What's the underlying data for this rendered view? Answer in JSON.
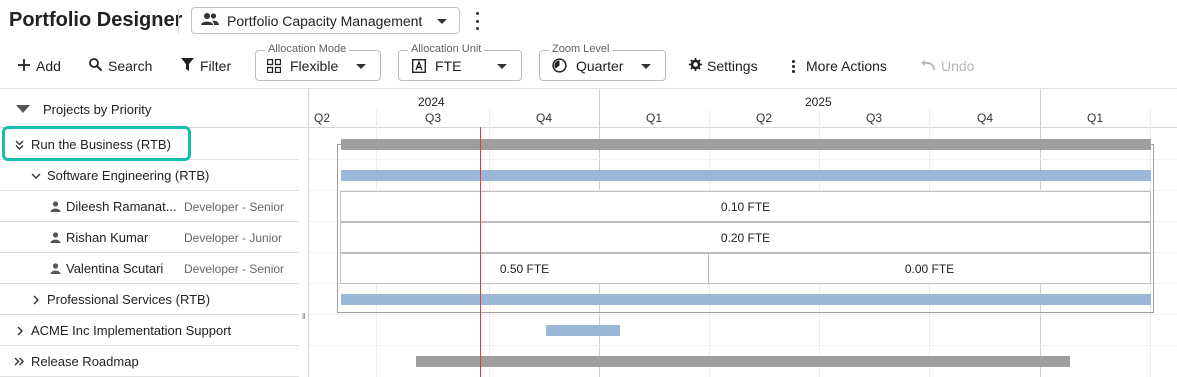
{
  "header": {
    "app_title": "Portfolio Designer",
    "view_selector": {
      "label": "Portfolio Capacity Management",
      "icon": "people-icon"
    }
  },
  "toolbar": {
    "add_label": "Add",
    "search_label": "Search",
    "filter_label": "Filter",
    "allocation_mode": {
      "legend": "Allocation Mode",
      "value": "Flexible",
      "icon": "grid-icon"
    },
    "allocation_unit": {
      "legend": "Allocation Unit",
      "value": "FTE",
      "icon": "letter-a-box-icon"
    },
    "zoom_level": {
      "legend": "Zoom Level",
      "value": "Quarter",
      "icon": "clock-half-icon"
    },
    "settings_label": "Settings",
    "more_actions_label": "More Actions",
    "undo_label": "Undo"
  },
  "tree": {
    "header_label": "Projects by Priority",
    "rows": [
      {
        "label": "Run the Business (RTB)",
        "toggle": "double-chevron-down"
      },
      {
        "label": "Software Engineering (RTB)",
        "toggle": "chevron-down"
      },
      {
        "name": "Dileesh Ramanathan",
        "name_display": "Dileesh Ramanat...",
        "role": "Developer - Senior"
      },
      {
        "name": "Rishan Kumar",
        "name_display": "Rishan Kumar",
        "role": "Developer - Junior"
      },
      {
        "name": "Valentina Scutari",
        "name_display": "Valentina Scutari",
        "role": "Developer - Senior"
      },
      {
        "label": "Professional Services (RTB)",
        "toggle": "chevron-right"
      },
      {
        "label": "ACME Inc Implementation Support",
        "toggle": "chevron-right"
      },
      {
        "label": "Release Roadmap",
        "toggle": "double-chevron-right"
      }
    ]
  },
  "timeline": {
    "years": [
      "2024",
      "2025"
    ],
    "quarters": [
      "Q2",
      "Q3",
      "Q4",
      "Q1",
      "Q2",
      "Q3",
      "Q4",
      "Q1"
    ],
    "allocations": {
      "dileesh": "0.10 FTE",
      "rishan": "0.20 FTE",
      "valentina_first": "0.50 FTE",
      "valentina_second": "0.00 FTE"
    }
  },
  "colors": {
    "highlight": "#16bfae",
    "project_bar": "#9e9e9e",
    "team_bar": "#9ab7d7",
    "today_line": "#e53935"
  }
}
